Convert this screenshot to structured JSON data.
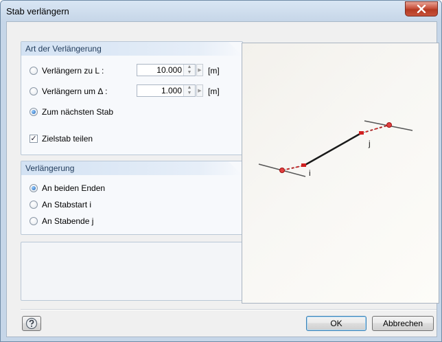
{
  "window": {
    "title": "Stab verlängern"
  },
  "group1": {
    "header": "Art der Verlängerung",
    "options": [
      {
        "label": "Verlängern zu L :",
        "value": "10.000",
        "unit": "[m]",
        "selected": false
      },
      {
        "label": "Verlängern um Δ :",
        "value": "1.000",
        "unit": "[m]",
        "selected": false
      },
      {
        "label": "Zum nächsten Stab",
        "selected": true
      }
    ],
    "checkbox": {
      "label": "Zielstab teilen",
      "checked": true
    }
  },
  "group2": {
    "header": "Verlängerung",
    "options": [
      {
        "label": "An beiden Enden",
        "selected": true
      },
      {
        "label": "An Stabstart i",
        "selected": false
      },
      {
        "label": "An Stabende j",
        "selected": false
      }
    ]
  },
  "preview": {
    "node_i": "i",
    "node_j": "j"
  },
  "buttons": {
    "ok": "OK",
    "cancel": "Abbrechen",
    "help_icon": "help-icon"
  },
  "colors": {
    "accent_red": "#d02020",
    "member": "#1a1a1a",
    "title_bar": "#c6d6e8"
  }
}
